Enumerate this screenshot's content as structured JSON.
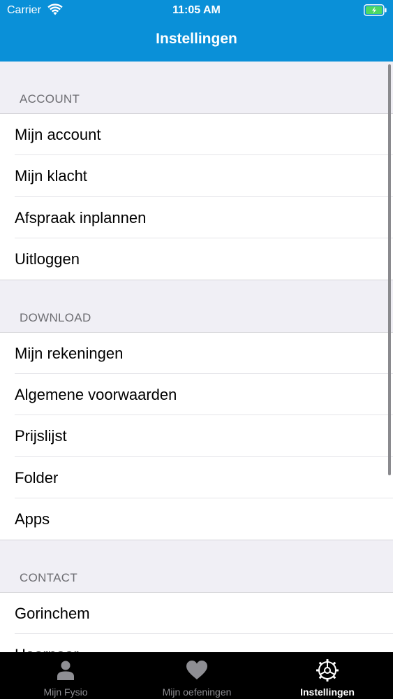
{
  "status_bar": {
    "carrier": "Carrier",
    "time": "11:05 AM"
  },
  "nav": {
    "title": "Instellingen"
  },
  "sections": [
    {
      "header": "ACCOUNT",
      "items": [
        "Mijn account",
        "Mijn klacht",
        "Afspraak inplannen",
        "Uitloggen"
      ]
    },
    {
      "header": "DOWNLOAD",
      "items": [
        "Mijn rekeningen",
        "Algemene voorwaarden",
        "Prijslijst",
        "Folder",
        "Apps"
      ]
    },
    {
      "header": "CONTACT",
      "items": [
        "Gorinchem",
        "Hoornaar"
      ]
    }
  ],
  "tabbar": {
    "tabs": [
      {
        "label": "Mijn Fysio",
        "icon": "person-icon"
      },
      {
        "label": "Mijn oefeningen",
        "icon": "heart-icon"
      },
      {
        "label": "Instellingen",
        "icon": "settings-icon"
      }
    ],
    "active_index": 2
  },
  "colors": {
    "accent": "#0a90d8",
    "tabbar_bg": "#000000",
    "tab_inactive": "#8e8e93",
    "battery": "#4cd964"
  }
}
